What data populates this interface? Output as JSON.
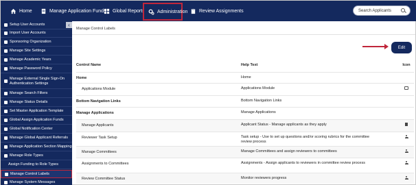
{
  "topnav": {
    "home": "Home",
    "funds": "Manage Application Funds",
    "reports": "Global Reports",
    "admin": "Administration",
    "review": "Review Assignments",
    "search_placeholder": "Search Applicants"
  },
  "sidebar": {
    "items": [
      {
        "label": "Setup User Accounts"
      },
      {
        "label": "Import User Accounts"
      },
      {
        "label": "Sponsoring Organization"
      },
      {
        "label": "Manage Site Settings"
      },
      {
        "label": "Manage Academic Years"
      },
      {
        "label": "Manage Password Policy"
      },
      {
        "label": "Manage External Single Sign-On Authentication Settings"
      },
      {
        "label": "Manage Search Filters"
      },
      {
        "label": "Manage Status Details"
      },
      {
        "label": "Set Master Application Template"
      },
      {
        "label": "Global Assign Application Funds"
      },
      {
        "label": "Global Notification Center"
      },
      {
        "label": "Manage Global Applicant Referrals"
      },
      {
        "label": "Manage Application Section Mapping"
      },
      {
        "label": "Manage Role Types"
      },
      {
        "label": "Assign Funding to Role Types"
      },
      {
        "label": "Manage Control Labels"
      },
      {
        "label": "Manage System Messages"
      }
    ]
  },
  "main": {
    "breadcrumb": "Manage Control Labels",
    "edit_label": "Edit",
    "columns": [
      "Control Name",
      "Help Text",
      "Icon"
    ],
    "rows": [
      {
        "name": "Home",
        "help": "Home",
        "icon": ""
      },
      {
        "name": "Applications Module",
        "help": "Applications Module",
        "icon": "pencil"
      },
      {
        "name": "Bottom Navigation Links",
        "help": "Bottom Navigation Links",
        "icon": ""
      },
      {
        "name": "Manage Applications",
        "help": "Manage Applications",
        "icon": ""
      },
      {
        "name": "Manage Applicants",
        "help": "Applicant Status - Manage applicants as they apply",
        "icon": "trash"
      },
      {
        "name": "Reviewer Task Setup",
        "help": "Task setup - Use to set up questions and/or scoring rubrics for the committee review process",
        "icon": "person"
      },
      {
        "name": "Manage Committees",
        "help": "Manage Committees and assign reviewers to committees",
        "icon": "person"
      },
      {
        "name": "Assignments to Committees",
        "help": "Assignments - Assign applicants to reviewers in committee review process",
        "icon": "person"
      },
      {
        "name": "Review Committee Status",
        "help": "Monitor reviewers progress",
        "icon": "person"
      }
    ]
  },
  "colors": {
    "nav_bg": "#14295e",
    "highlight": "#c0263a"
  }
}
